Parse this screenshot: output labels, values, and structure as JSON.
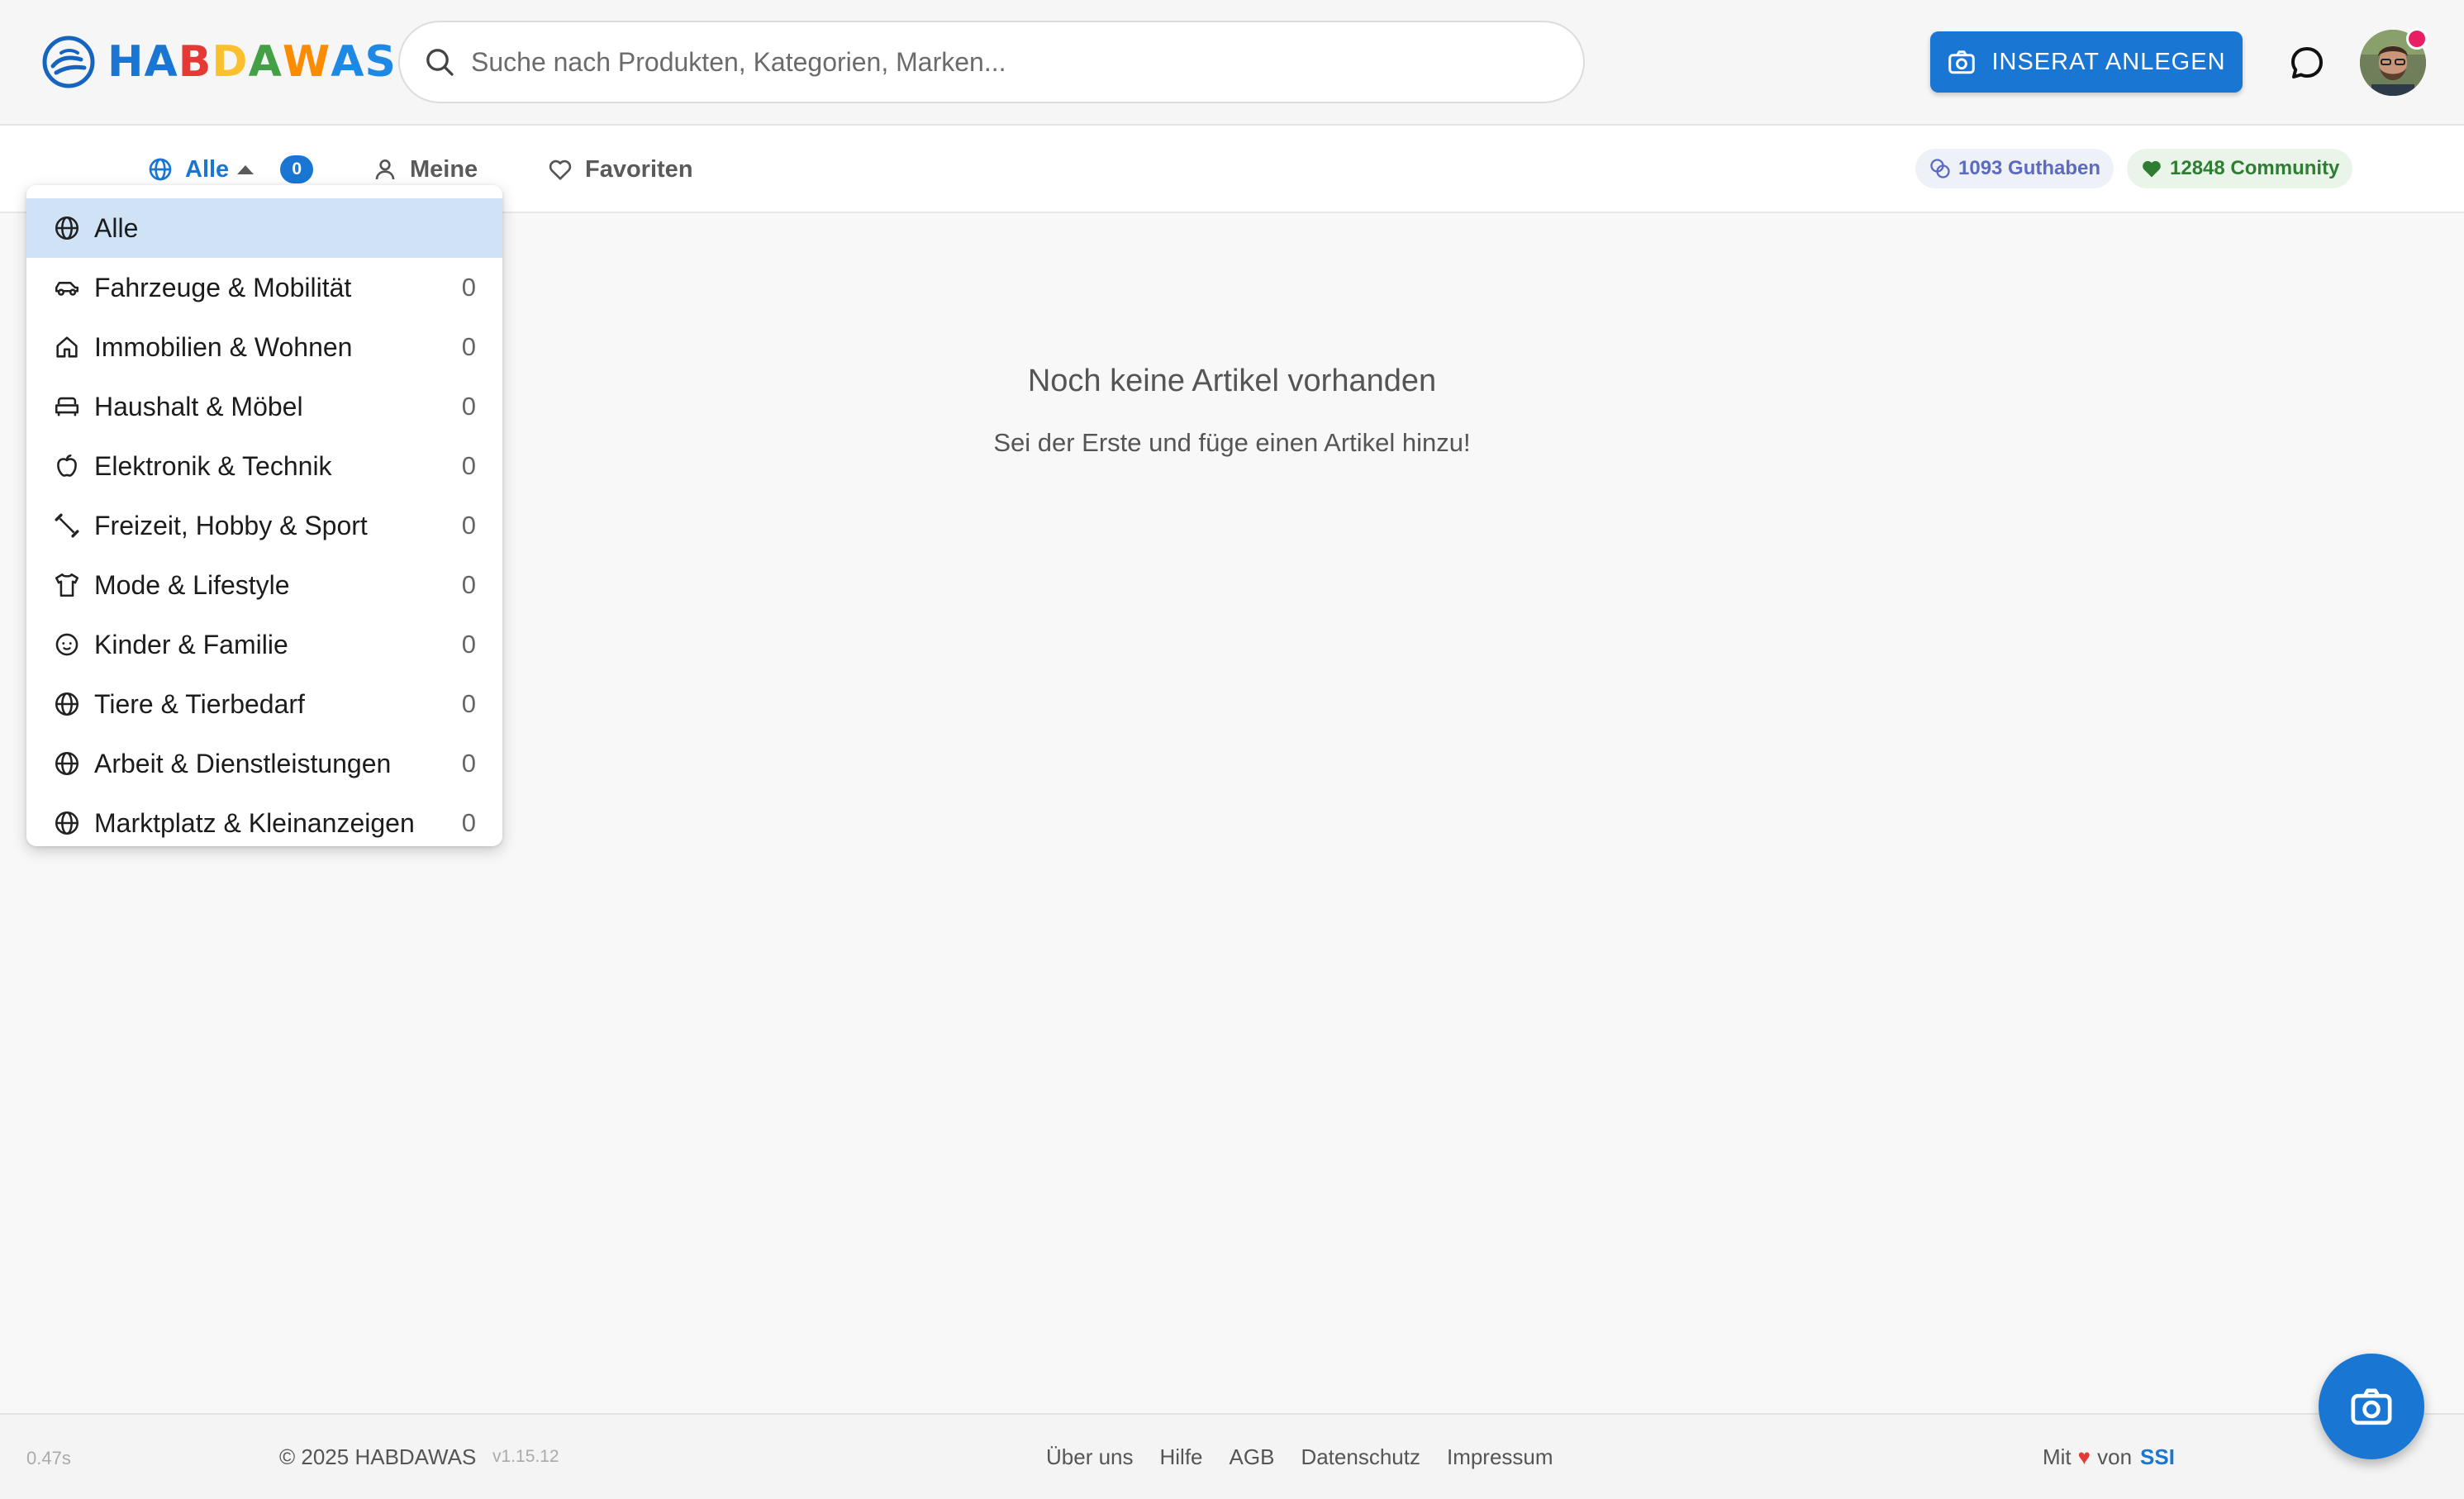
{
  "header": {
    "logo_letters": [
      {
        "ch": "H",
        "color": "#1976d2"
      },
      {
        "ch": "A",
        "color": "#1976d2"
      },
      {
        "ch": "B",
        "color": "#e53935"
      },
      {
        "ch": "D",
        "color": "#fbc02d"
      },
      {
        "ch": "A",
        "color": "#43a047"
      },
      {
        "ch": "W",
        "color": "#fb8c00"
      },
      {
        "ch": "A",
        "color": "#1e88e5"
      },
      {
        "ch": "S",
        "color": "#1e88e5"
      }
    ],
    "search_placeholder": "Suche nach Produkten, Kategorien, Marken...",
    "create_label": "INSERAT ANLEGEN"
  },
  "nav": {
    "tab_all": "Alle",
    "tab_all_count": "0",
    "tab_mine": "Meine",
    "tab_favorites": "Favoriten",
    "credit_label": "1093 Guthaben",
    "community_label": "12848 Community"
  },
  "empty": {
    "title": "Noch keine Artikel vorhanden",
    "subtitle": "Sei der Erste und füge einen Artikel hinzu!"
  },
  "dropdown": {
    "items": [
      {
        "label": "Alle",
        "count": "",
        "icon": "globe-icon"
      },
      {
        "label": "Fahrzeuge & Mobilität",
        "count": "0",
        "icon": "car-icon"
      },
      {
        "label": "Immobilien & Wohnen",
        "count": "0",
        "icon": "house-icon"
      },
      {
        "label": "Haushalt & Möbel",
        "count": "0",
        "icon": "sofa-icon"
      },
      {
        "label": "Elektronik & Technik",
        "count": "0",
        "icon": "apple-icon"
      },
      {
        "label": "Freizeit, Hobby & Sport",
        "count": "0",
        "icon": "dumbbell-icon"
      },
      {
        "label": "Mode & Lifestyle",
        "count": "0",
        "icon": "shirt-icon"
      },
      {
        "label": "Kinder & Familie",
        "count": "0",
        "icon": "baby-icon"
      },
      {
        "label": "Tiere & Tierbedarf",
        "count": "0",
        "icon": "globe-icon"
      },
      {
        "label": "Arbeit & Dienstleistungen",
        "count": "0",
        "icon": "globe-icon"
      },
      {
        "label": "Marktplatz & Kleinanzeigen",
        "count": "0",
        "icon": "globe-icon"
      }
    ]
  },
  "footer": {
    "timing": "0.47s",
    "copyright": "© 2025 HABDAWAS",
    "version": "v1.15.12",
    "links": [
      "Über uns",
      "Hilfe",
      "AGB",
      "Datenschutz",
      "Impressum"
    ],
    "made_prefix": "Mit",
    "made_mid": "von",
    "made_brand": "SSI"
  },
  "colors": {
    "primary": "#1976d2",
    "selected_bg": "#cfe2f6",
    "community": "#2e7d32",
    "credit": "#5c6bc0",
    "badge": "#e91e63"
  }
}
